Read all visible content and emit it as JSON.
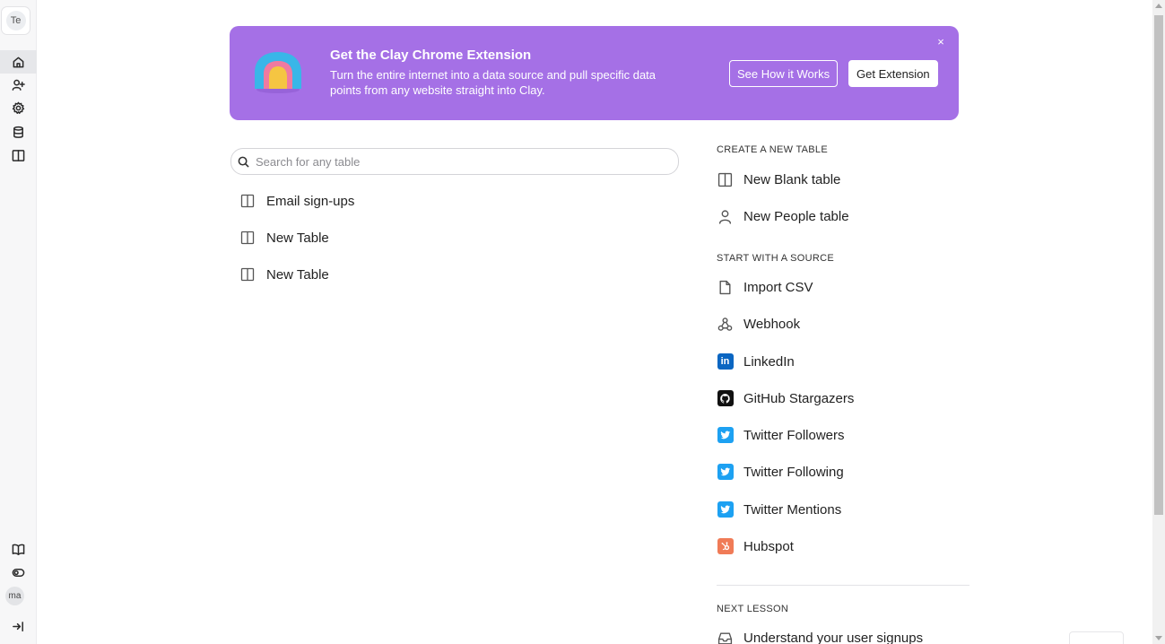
{
  "sidebar": {
    "workspace_initials": "Te",
    "user_initials": "ma"
  },
  "banner": {
    "title": "Get the Clay Chrome Extension",
    "description": "Turn the entire internet into a data source and pull specific data points from any website straight into Clay.",
    "see_how_label": "See How it Works",
    "get_extension_label": "Get Extension",
    "close_glyph": "×",
    "background_color": "#a570e6"
  },
  "search": {
    "placeholder": "Search for any table",
    "value": ""
  },
  "tables": [
    {
      "label": "Email sign-ups",
      "icon": "table-icon"
    },
    {
      "label": "New Table",
      "icon": "table-icon"
    },
    {
      "label": "New Table",
      "icon": "table-icon"
    }
  ],
  "create": {
    "heading": "CREATE A NEW TABLE",
    "items": [
      {
        "label": "New Blank table",
        "icon": "table-icon"
      },
      {
        "label": "New People table",
        "icon": "person-icon"
      }
    ]
  },
  "sources": {
    "heading": "START WITH A SOURCE",
    "items": [
      {
        "label": "Import CSV",
        "icon": "file-icon"
      },
      {
        "label": "Webhook",
        "icon": "webhook-icon"
      },
      {
        "label": "LinkedIn",
        "icon": "linkedin-icon",
        "color": "#0a66c2"
      },
      {
        "label": "GitHub Stargazers",
        "icon": "github-icon",
        "color": "#111111"
      },
      {
        "label": "Twitter Followers",
        "icon": "twitter-icon",
        "color": "#1da1f2"
      },
      {
        "label": "Twitter Following",
        "icon": "twitter-icon",
        "color": "#1da1f2"
      },
      {
        "label": "Twitter Mentions",
        "icon": "twitter-icon",
        "color": "#1da1f2"
      },
      {
        "label": "Hubspot",
        "icon": "hubspot-icon",
        "color": "#f07b57"
      }
    ]
  },
  "lesson": {
    "heading": "NEXT LESSON",
    "label": "Understand your user signups",
    "icon": "inbox-icon"
  }
}
